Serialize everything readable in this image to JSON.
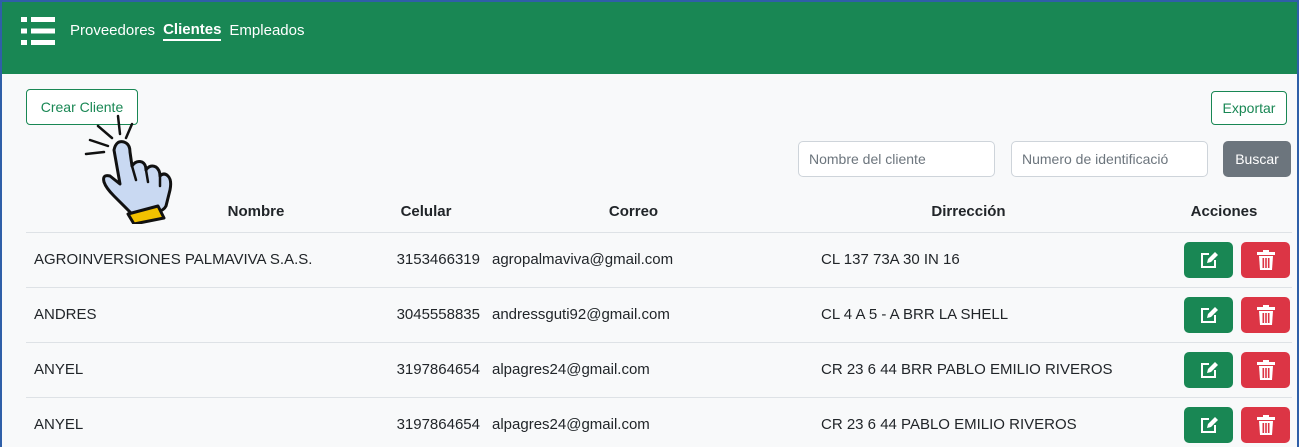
{
  "nav": {
    "links": [
      {
        "label": "Proveedores",
        "active": false
      },
      {
        "label": "Clientes",
        "active": true
      },
      {
        "label": "Empleados",
        "active": false
      }
    ]
  },
  "toolbar": {
    "create_label": "Crear Cliente",
    "export_label": "Exportar"
  },
  "search": {
    "name_placeholder": "Nombre del cliente",
    "id_placeholder": "Numero de identificació",
    "button_label": "Buscar"
  },
  "table": {
    "headers": [
      "Nombre",
      "Celular",
      "Correo",
      "Dirrección",
      "Acciones"
    ],
    "rows": [
      {
        "nombre": "AGROINVERSIONES PALMAVIVA S.A.S.",
        "celular": "3153466319",
        "correo": "agropalmaviva@gmail.com",
        "direccion": "CL 137 73A 30 IN 16"
      },
      {
        "nombre": "ANDRES",
        "celular": "3045558835",
        "correo": "andressguti92@gmail.com",
        "direccion": "CL 4 A 5 - A BRR LA SHELL"
      },
      {
        "nombre": "ANYEL",
        "celular": "3197864654",
        "correo": "alpagres24@gmail.com",
        "direccion": "CR 23 6 44 BRR PABLO EMILIO RIVEROS"
      },
      {
        "nombre": "ANYEL",
        "celular": "3197864654",
        "correo": "alpagres24@gmail.com",
        "direccion": "CR 23 6 44 PABLO EMILIO RIVEROS"
      }
    ]
  },
  "icons": {
    "menu": "list-icon",
    "edit": "edit-icon",
    "delete": "trash-icon",
    "cursor": "pointing-hand-icon"
  },
  "colors": {
    "primary": "#198754",
    "danger": "#dc3545",
    "secondary": "#6c757d",
    "frame": "#2f5fa8"
  }
}
